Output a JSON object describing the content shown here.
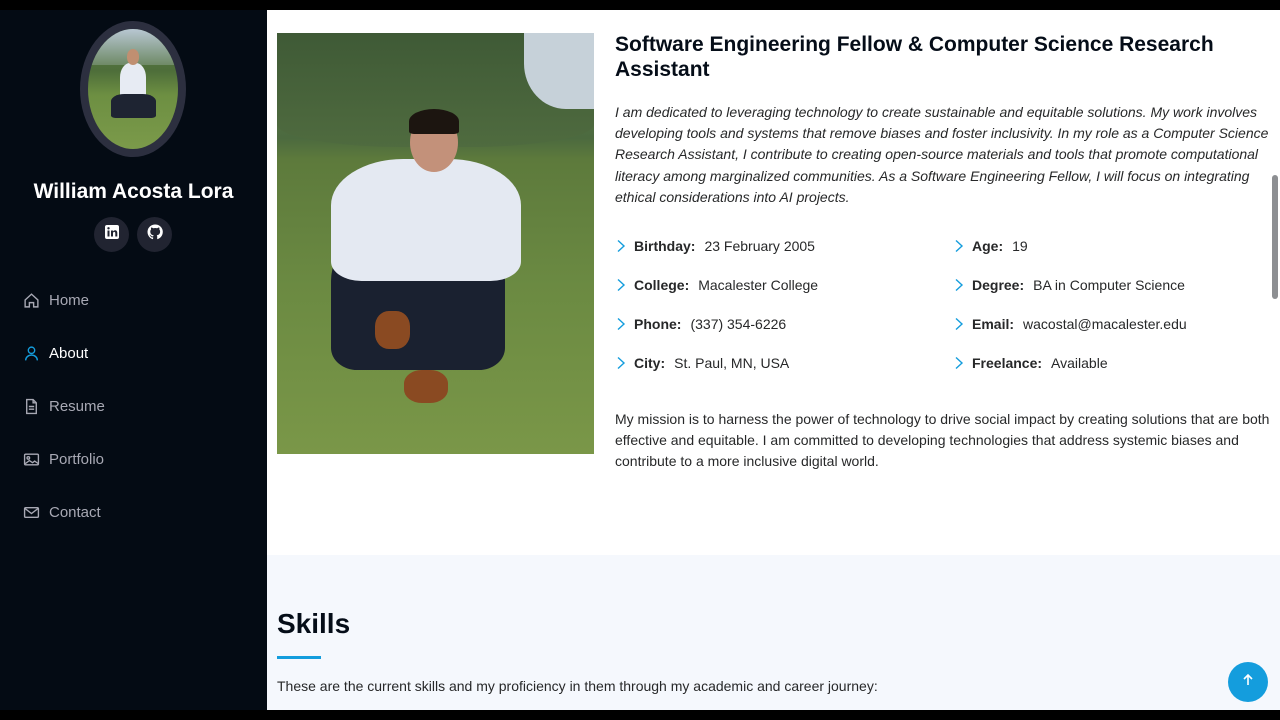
{
  "profile": {
    "name": "William Acosta Lora",
    "social": [
      {
        "icon": "linkedin-icon"
      },
      {
        "icon": "github-icon"
      }
    ]
  },
  "nav": {
    "items": [
      {
        "label": "Home",
        "icon": "home-icon"
      },
      {
        "label": "About",
        "icon": "user-icon",
        "active": true
      },
      {
        "label": "Resume",
        "icon": "file-icon"
      },
      {
        "label": "Portfolio",
        "icon": "image-icon"
      },
      {
        "label": "Contact",
        "icon": "envelope-icon"
      }
    ]
  },
  "about": {
    "title": "Software Engineering Fellow & Computer Science Research Assistant",
    "intro": "I am dedicated to leveraging technology to create sustainable and equitable solutions. My work involves developing tools and systems that remove biases and foster inclusivity. In my role as a Computer Science Research Assistant, I contribute to creating open-source materials and tools that promote computational literacy among marginalized communities. As a Software Engineering Fellow, I will focus on integrating ethical considerations into AI projects.",
    "facts": [
      {
        "key": "Birthday:",
        "value": "23 February 2005"
      },
      {
        "key": "Age:",
        "value": "19"
      },
      {
        "key": "College:",
        "value": "Macalester College"
      },
      {
        "key": "Degree:",
        "value": "BA in Computer Science"
      },
      {
        "key": "Phone:",
        "value": "(337) 354-6226"
      },
      {
        "key": "Email:",
        "value": "wacostal@macalester.edu"
      },
      {
        "key": "City:",
        "value": "St. Paul, MN, USA"
      },
      {
        "key": "Freelance:",
        "value": "Available"
      }
    ],
    "mission": "My mission is to harness the power of technology to drive social impact by creating solutions that are both effective and equitable. I am committed to developing technologies that address systemic biases and contribute to a more inclusive digital world."
  },
  "skills": {
    "title": "Skills",
    "description": "These are the current skills and my proficiency in them through my academic and career journey:"
  },
  "colors": {
    "accent": "#149ddd",
    "sidebar_bg": "#040b14",
    "section_alt_bg": "#f5f8fd"
  }
}
